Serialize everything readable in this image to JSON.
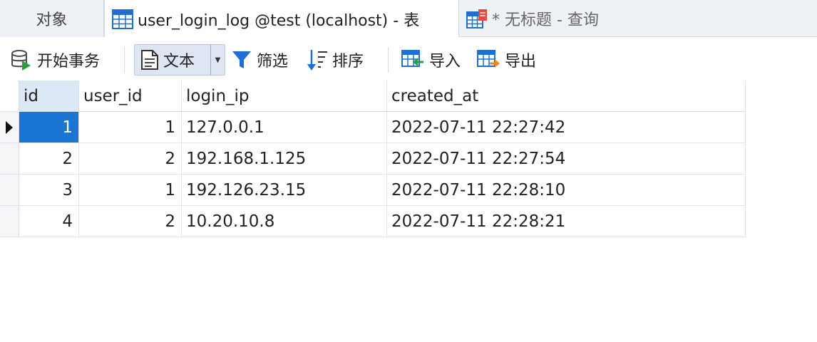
{
  "tabs": {
    "objects_label": "对象",
    "table_label": "user_login_log @test (localhost) - 表",
    "query_label": "* 无标题 - 查询"
  },
  "toolbar": {
    "begin_transaction": "开始事务",
    "text": "文本",
    "filter": "筛选",
    "sort": "排序",
    "import": "导入",
    "export": "导出"
  },
  "grid": {
    "columns": [
      "id",
      "user_id",
      "login_ip",
      "created_at"
    ],
    "rows": [
      [
        "1",
        "1",
        "127.0.0.1",
        "2022-07-11 22:27:42"
      ],
      [
        "2",
        "2",
        "192.168.1.125",
        "2022-07-11 22:27:54"
      ],
      [
        "3",
        "1",
        "192.126.23.15",
        "2022-07-11 22:28:10"
      ],
      [
        "4",
        "2",
        "10.20.10.8",
        "2022-07-11 22:28:21"
      ]
    ]
  },
  "colors": {
    "selection": "#1a76d2",
    "accent_icon": "#1e6fcf",
    "tab_bar_bg": "#eef1f6"
  },
  "icons": {
    "table_tab": "table-grid-icon",
    "query_tab": "query-icon",
    "begin_transaction": "database-play-icon",
    "text": "document-icon",
    "filter": "funnel-icon",
    "sort": "sort-icon",
    "import": "import-icon",
    "export": "export-icon",
    "current_row": "row-pointer-icon"
  }
}
